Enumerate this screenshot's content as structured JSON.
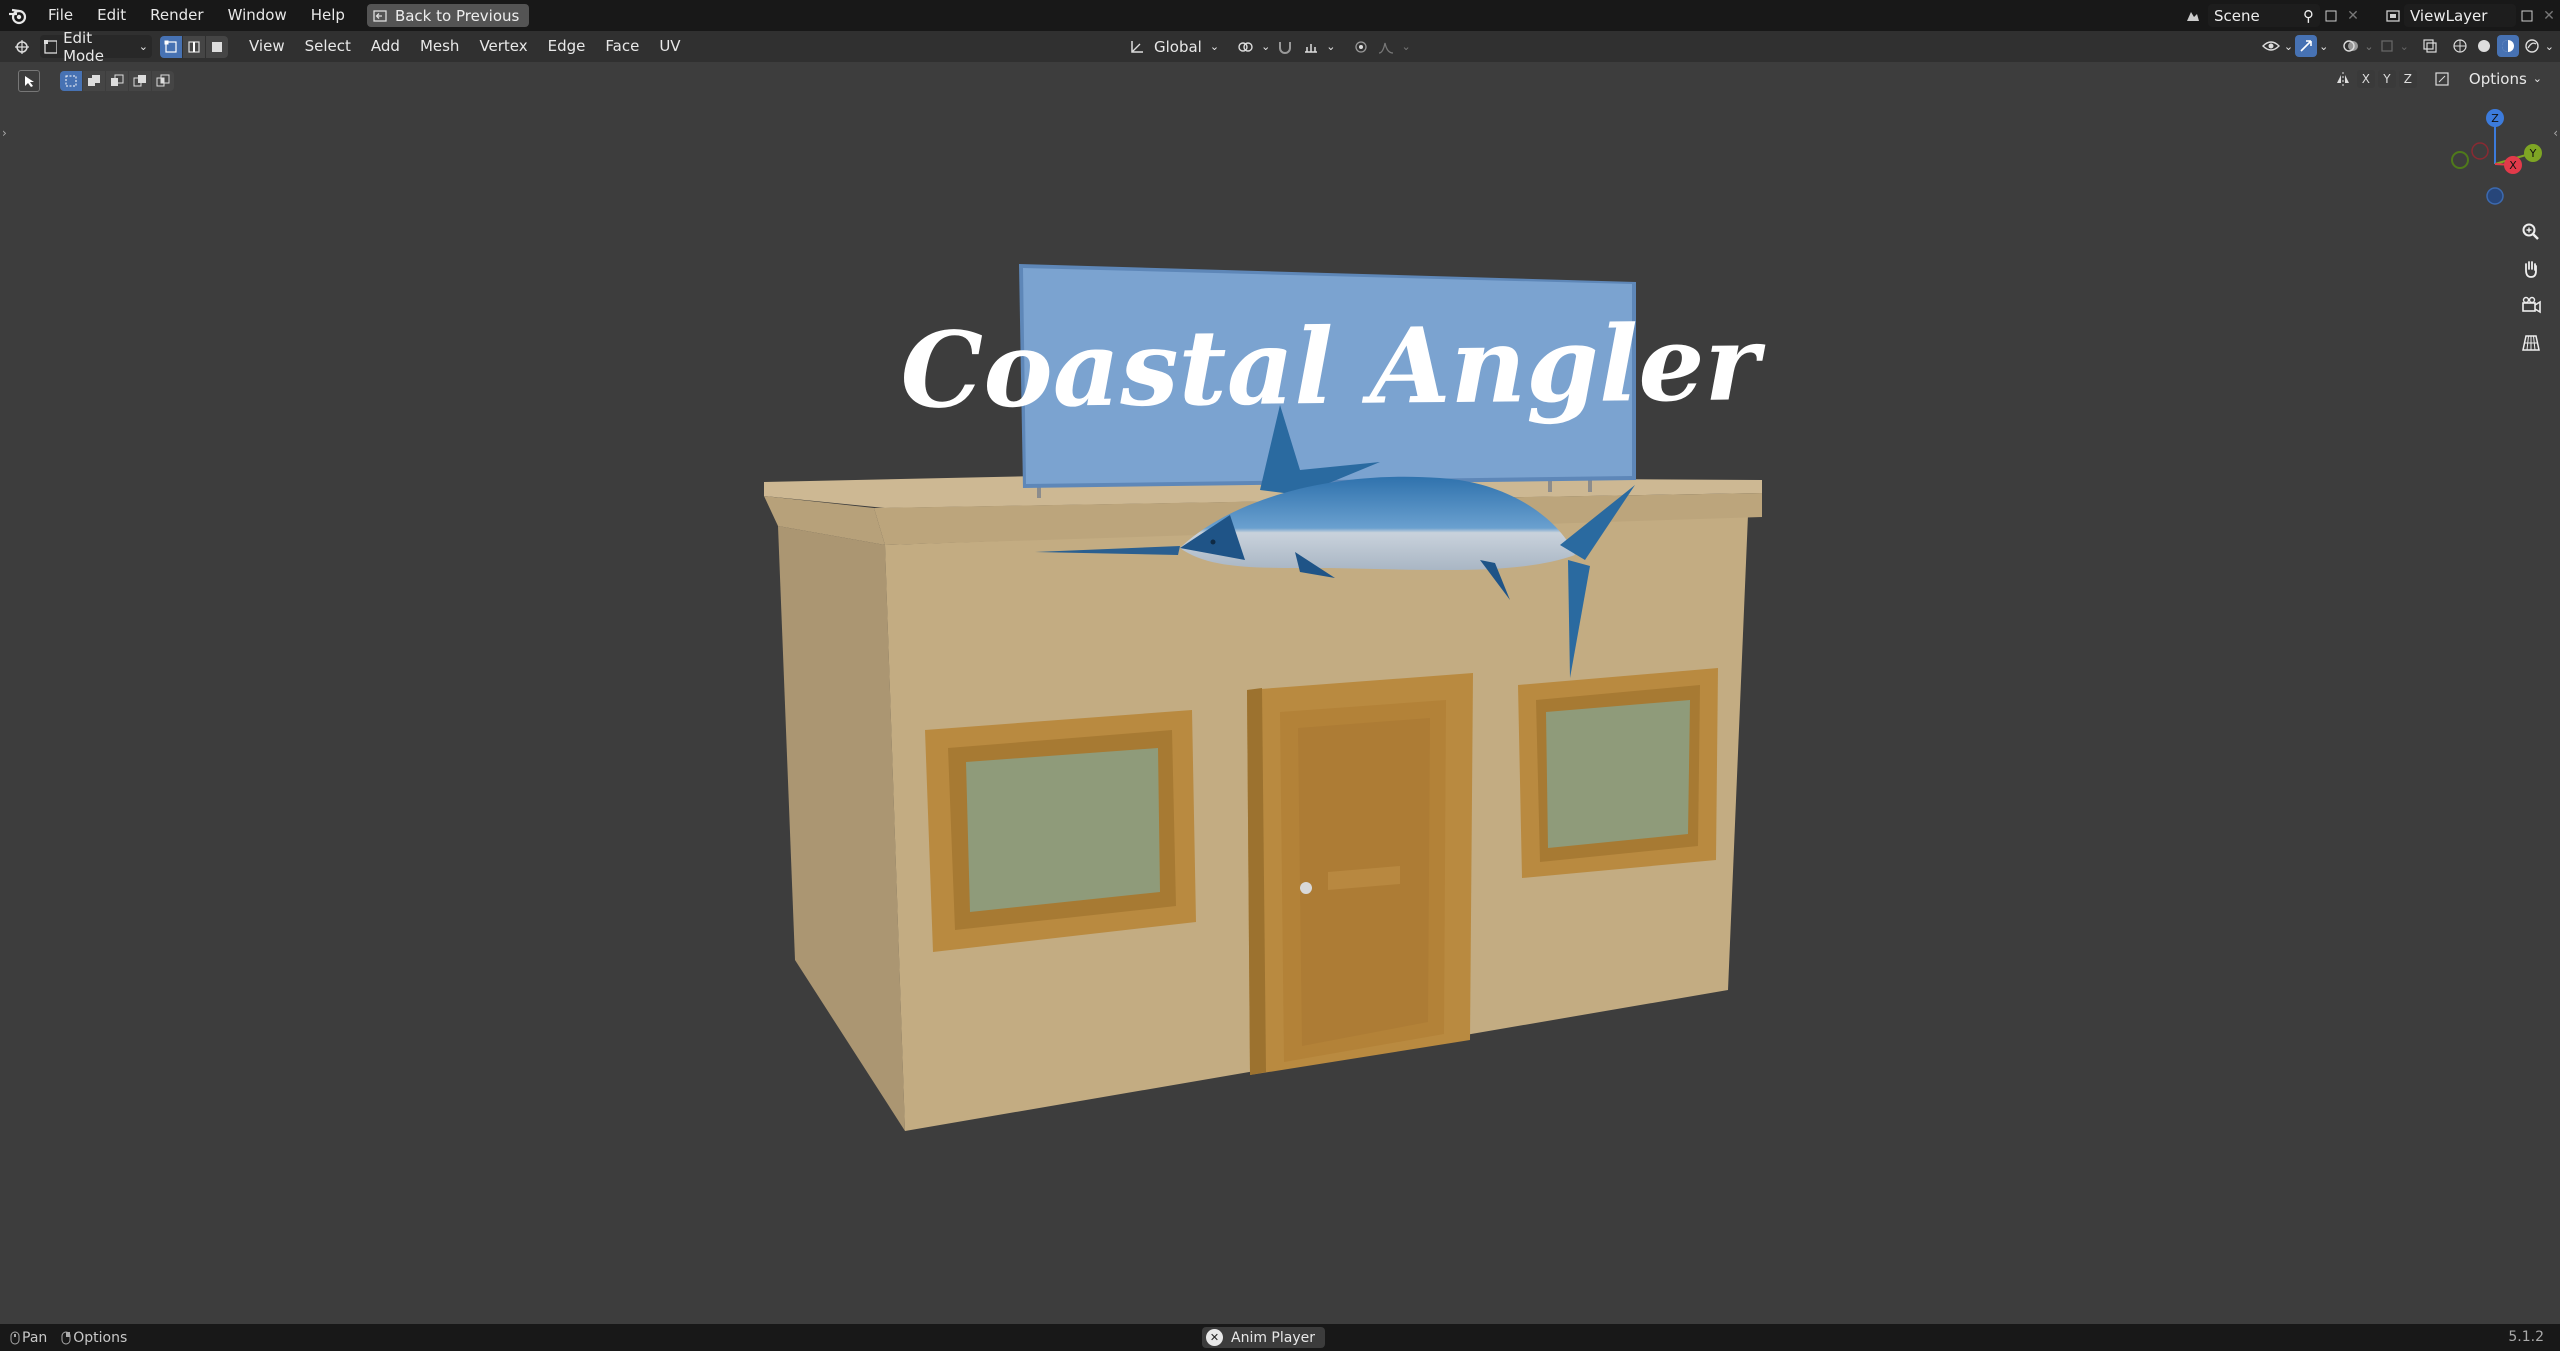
{
  "top_menu": {
    "items": [
      "File",
      "Edit",
      "Render",
      "Window",
      "Help"
    ],
    "back_button": "Back to Previous",
    "scene": "Scene",
    "view_layer": "ViewLayer"
  },
  "viewport_header": {
    "mode": "Edit Mode",
    "menus": [
      "View",
      "Select",
      "Add",
      "Mesh",
      "Vertex",
      "Edge",
      "Face",
      "UV"
    ],
    "transform_orientation": "Global",
    "options_label": "Options",
    "axis_labels": [
      "X",
      "Y",
      "Z"
    ]
  },
  "gizmo": {
    "z": "Z",
    "y": "Y",
    "x": "X"
  },
  "scene_content": {
    "sign_text": "Coastal Angler",
    "colors": {
      "sign": "#7ba3d0",
      "wall": "#c2aa80",
      "trim": "#b98a40",
      "glass": "#8f9b7a",
      "fish_blue": "#2a6aa0",
      "fish_belly": "#c9d2dc"
    }
  },
  "status_bar": {
    "left_pan": "Pan",
    "left_options": "Options",
    "center_chip": "Anim Player",
    "version": "5.1.2"
  }
}
